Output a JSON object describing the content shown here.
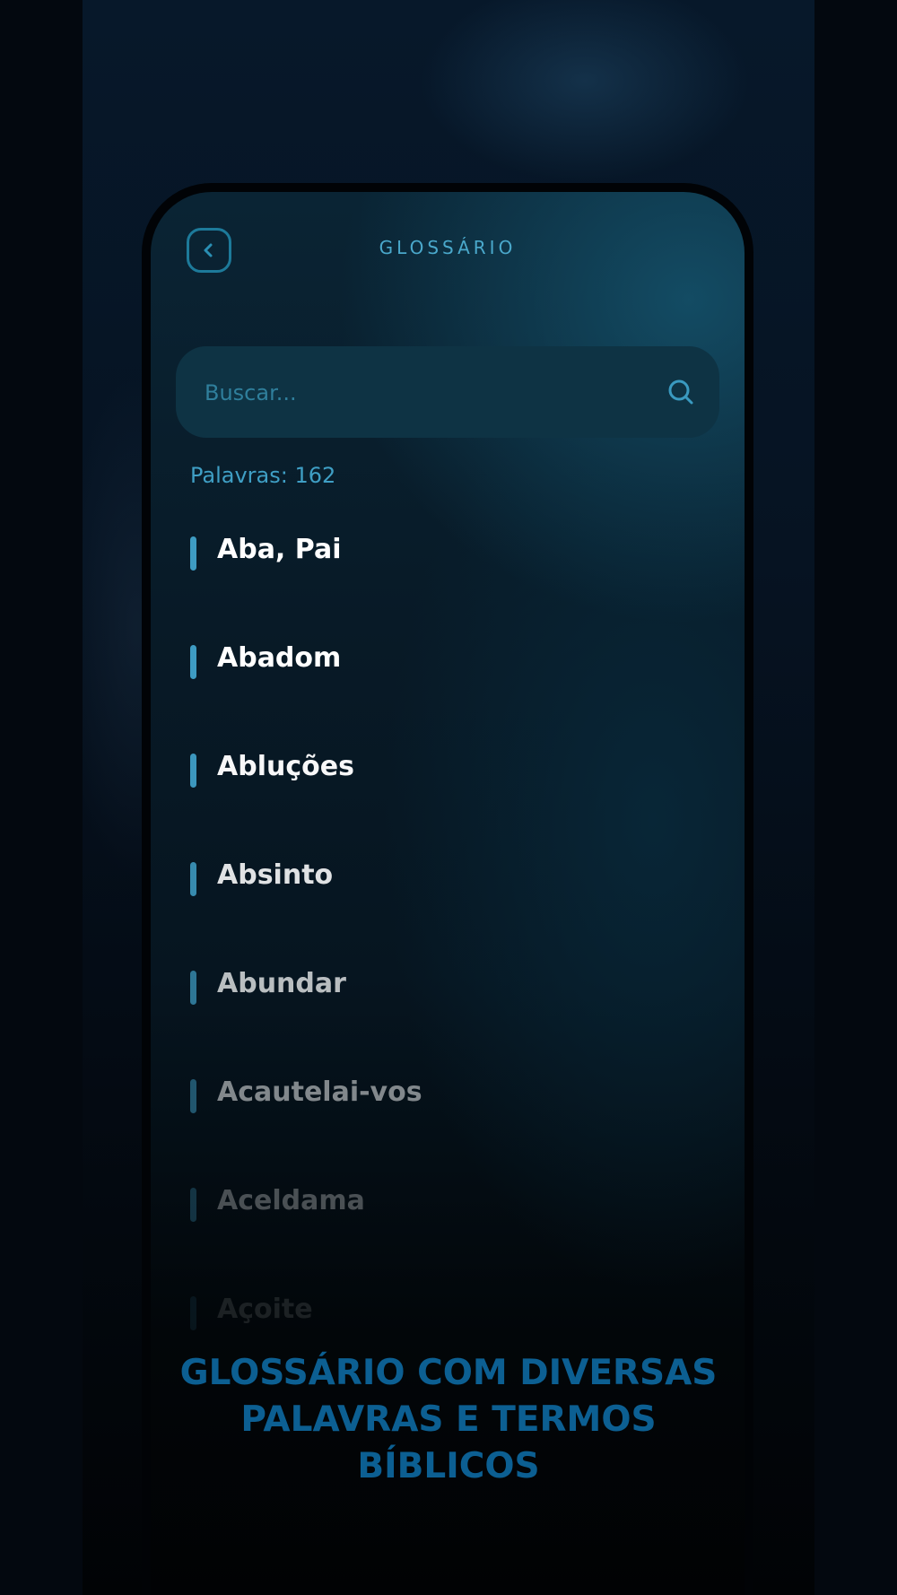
{
  "header": {
    "title": "GLOSSÁRIO",
    "back_icon": "chevron-left-icon"
  },
  "search": {
    "placeholder": "Buscar...",
    "icon": "search-icon"
  },
  "word_count": "Palavras: 162",
  "glossary": {
    "items": [
      {
        "label": "Aba, Pai"
      },
      {
        "label": "Abadom"
      },
      {
        "label": "Abluções"
      },
      {
        "label": "Absinto"
      },
      {
        "label": "Abundar"
      },
      {
        "label": "Acautelai-vos"
      },
      {
        "label": "Aceldama"
      },
      {
        "label": "Açoite"
      }
    ]
  },
  "caption": {
    "line1": "GLOSSÁRIO COM DIVERSAS",
    "line2": "PALAVRAS E TERMOS",
    "line3": "BÍBLICOS"
  },
  "colors": {
    "accent": "#3e9cc3",
    "title": "#4aa8cb",
    "caption": "#0c5f92",
    "search_bg": "#0e3344"
  }
}
